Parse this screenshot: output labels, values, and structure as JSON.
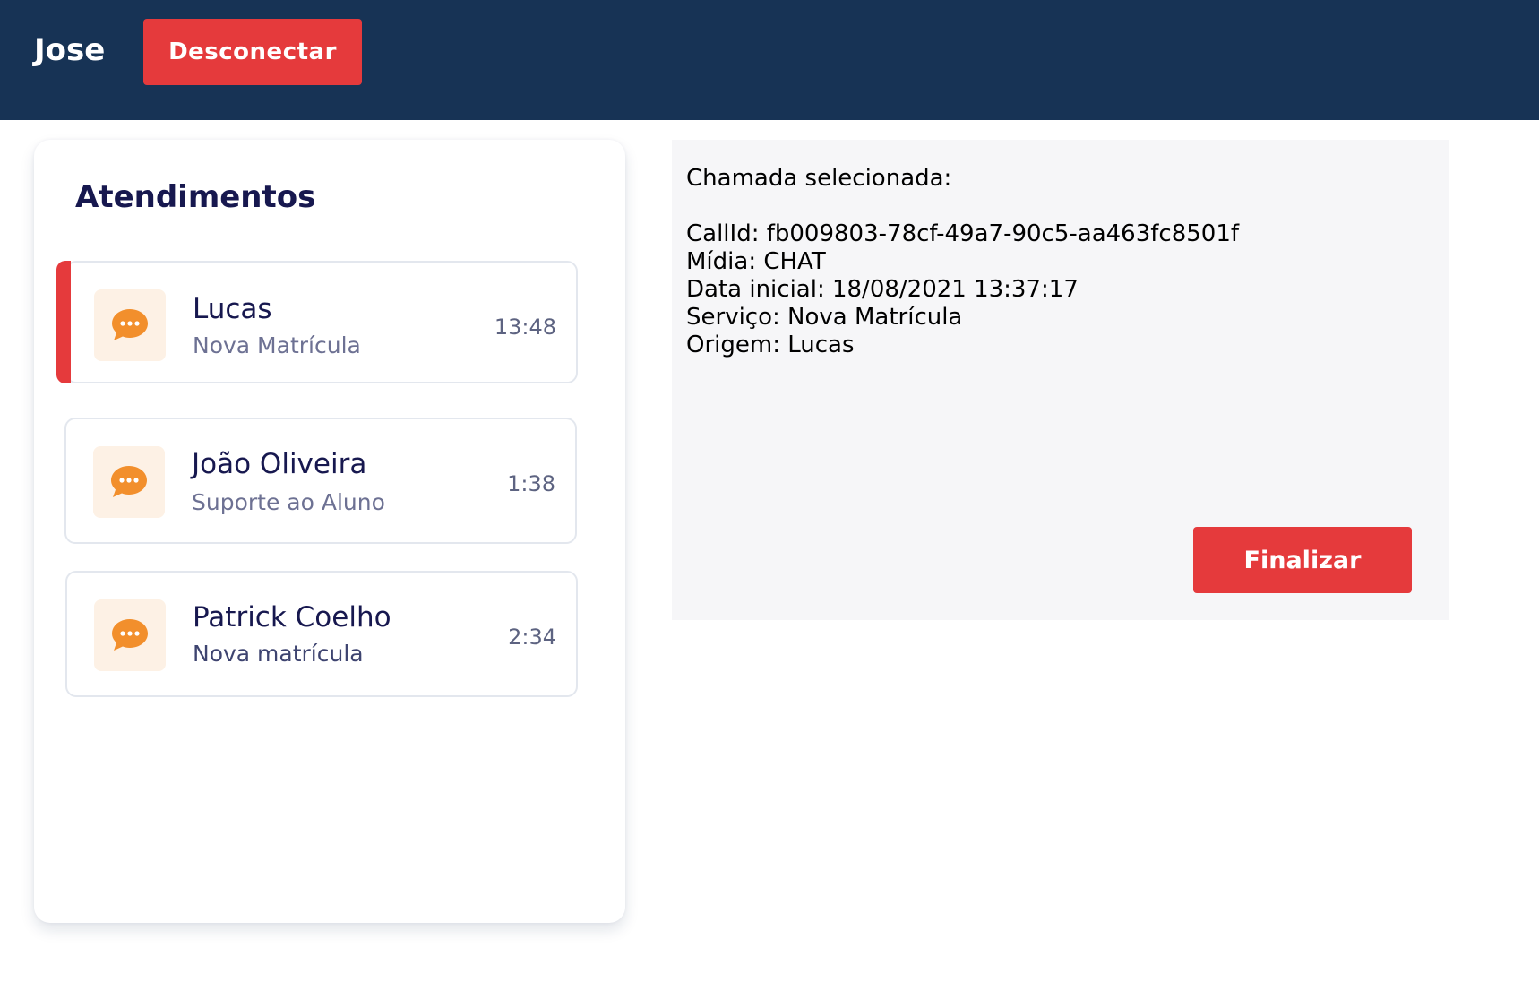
{
  "header": {
    "username": "Jose",
    "logout_label": "Desconectar"
  },
  "attendances": {
    "title": "Atendimentos",
    "items": [
      {
        "name": "Lucas",
        "service": "Nova Matrícula",
        "time": "13:48",
        "selected": true,
        "icon": "chat-icon"
      },
      {
        "name": "João Oliveira",
        "service": "Suporte ao Aluno",
        "time": "1:38",
        "selected": false,
        "icon": "chat-icon"
      },
      {
        "name": "Patrick Coelho",
        "service": "Nova matrícula",
        "time": "2:34",
        "selected": false,
        "icon": "chat-icon"
      }
    ]
  },
  "detail": {
    "heading": "Chamada selecionada:",
    "call_id_line": "CallId: fb009803-78cf-49a7-90c5-aa463fc8501f",
    "media_line": "Mídia: CHAT",
    "start_line": "Data inicial: 18/08/2021 13:37:17",
    "service_line": "Serviço: Nova Matrícula",
    "origin_line": "Origem: Lucas",
    "finalize_label": "Finalizar"
  },
  "colors": {
    "header_bg": "#173355",
    "accent_red": "#e53a3c",
    "chat_icon": "#f28f2c",
    "chat_icon_bg": "#fdf1e5"
  }
}
